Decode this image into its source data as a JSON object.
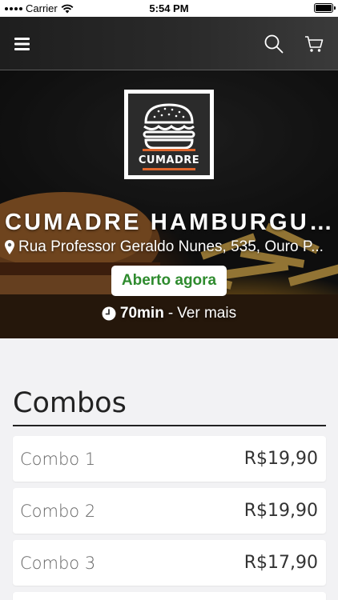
{
  "status_bar": {
    "carrier": "Carrier",
    "time": "5:54 PM"
  },
  "nav": {
    "menu_icon": "hamburger-menu-icon",
    "search_icon": "search-icon",
    "cart_icon": "cart-icon"
  },
  "restaurant": {
    "logo_text": "CUMADRE",
    "name": "CUMADRE HAMBURGUE...",
    "address": "Rua Professor Geraldo Nunes, 535, Ouro P...",
    "status": "Aberto agora",
    "delivery_time": "70min",
    "separator": "-",
    "more_link": "Ver mais",
    "status_color": "#2e8b2e"
  },
  "menu": {
    "section_title": "Combos",
    "items": [
      {
        "name": "Combo 1",
        "price": "R$19,90"
      },
      {
        "name": "Combo 2",
        "price": "R$19,90"
      },
      {
        "name": "Combo 3",
        "price": "R$17,90"
      }
    ]
  }
}
